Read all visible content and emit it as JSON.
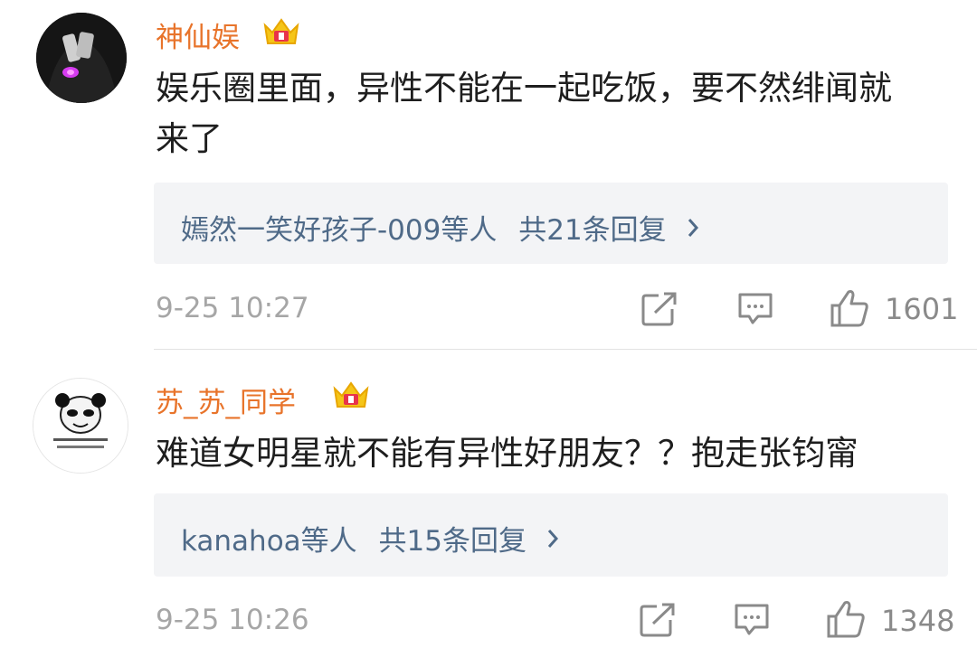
{
  "comments": [
    {
      "username": "神仙娱",
      "content": "娱乐圈里面，异性不能在一起吃饭，要不然绯闻就来了",
      "reply_users": "嫣然一笑好孩子-009等人",
      "reply_count": "共21条回复",
      "time": "9-25 10:27",
      "likes": "1601"
    },
    {
      "username": "苏_苏_同学",
      "content": "难道女明星就不能有异性好朋友？？抱走张钧甯",
      "reply_users": "kanahoa等人",
      "reply_count": "共15条回复",
      "time": "9-25 10:26",
      "likes": "1348"
    }
  ],
  "icons": {
    "crown": "crown-icon",
    "share": "share-icon",
    "comment": "comment-icon",
    "like": "thumbs-up-icon",
    "chevron": "chevron-right-icon"
  },
  "colors": {
    "username": "#e8742b",
    "reply_link": "#4f6a88",
    "meta": "#a6a6a6",
    "reply_bg": "#f3f4f6"
  }
}
